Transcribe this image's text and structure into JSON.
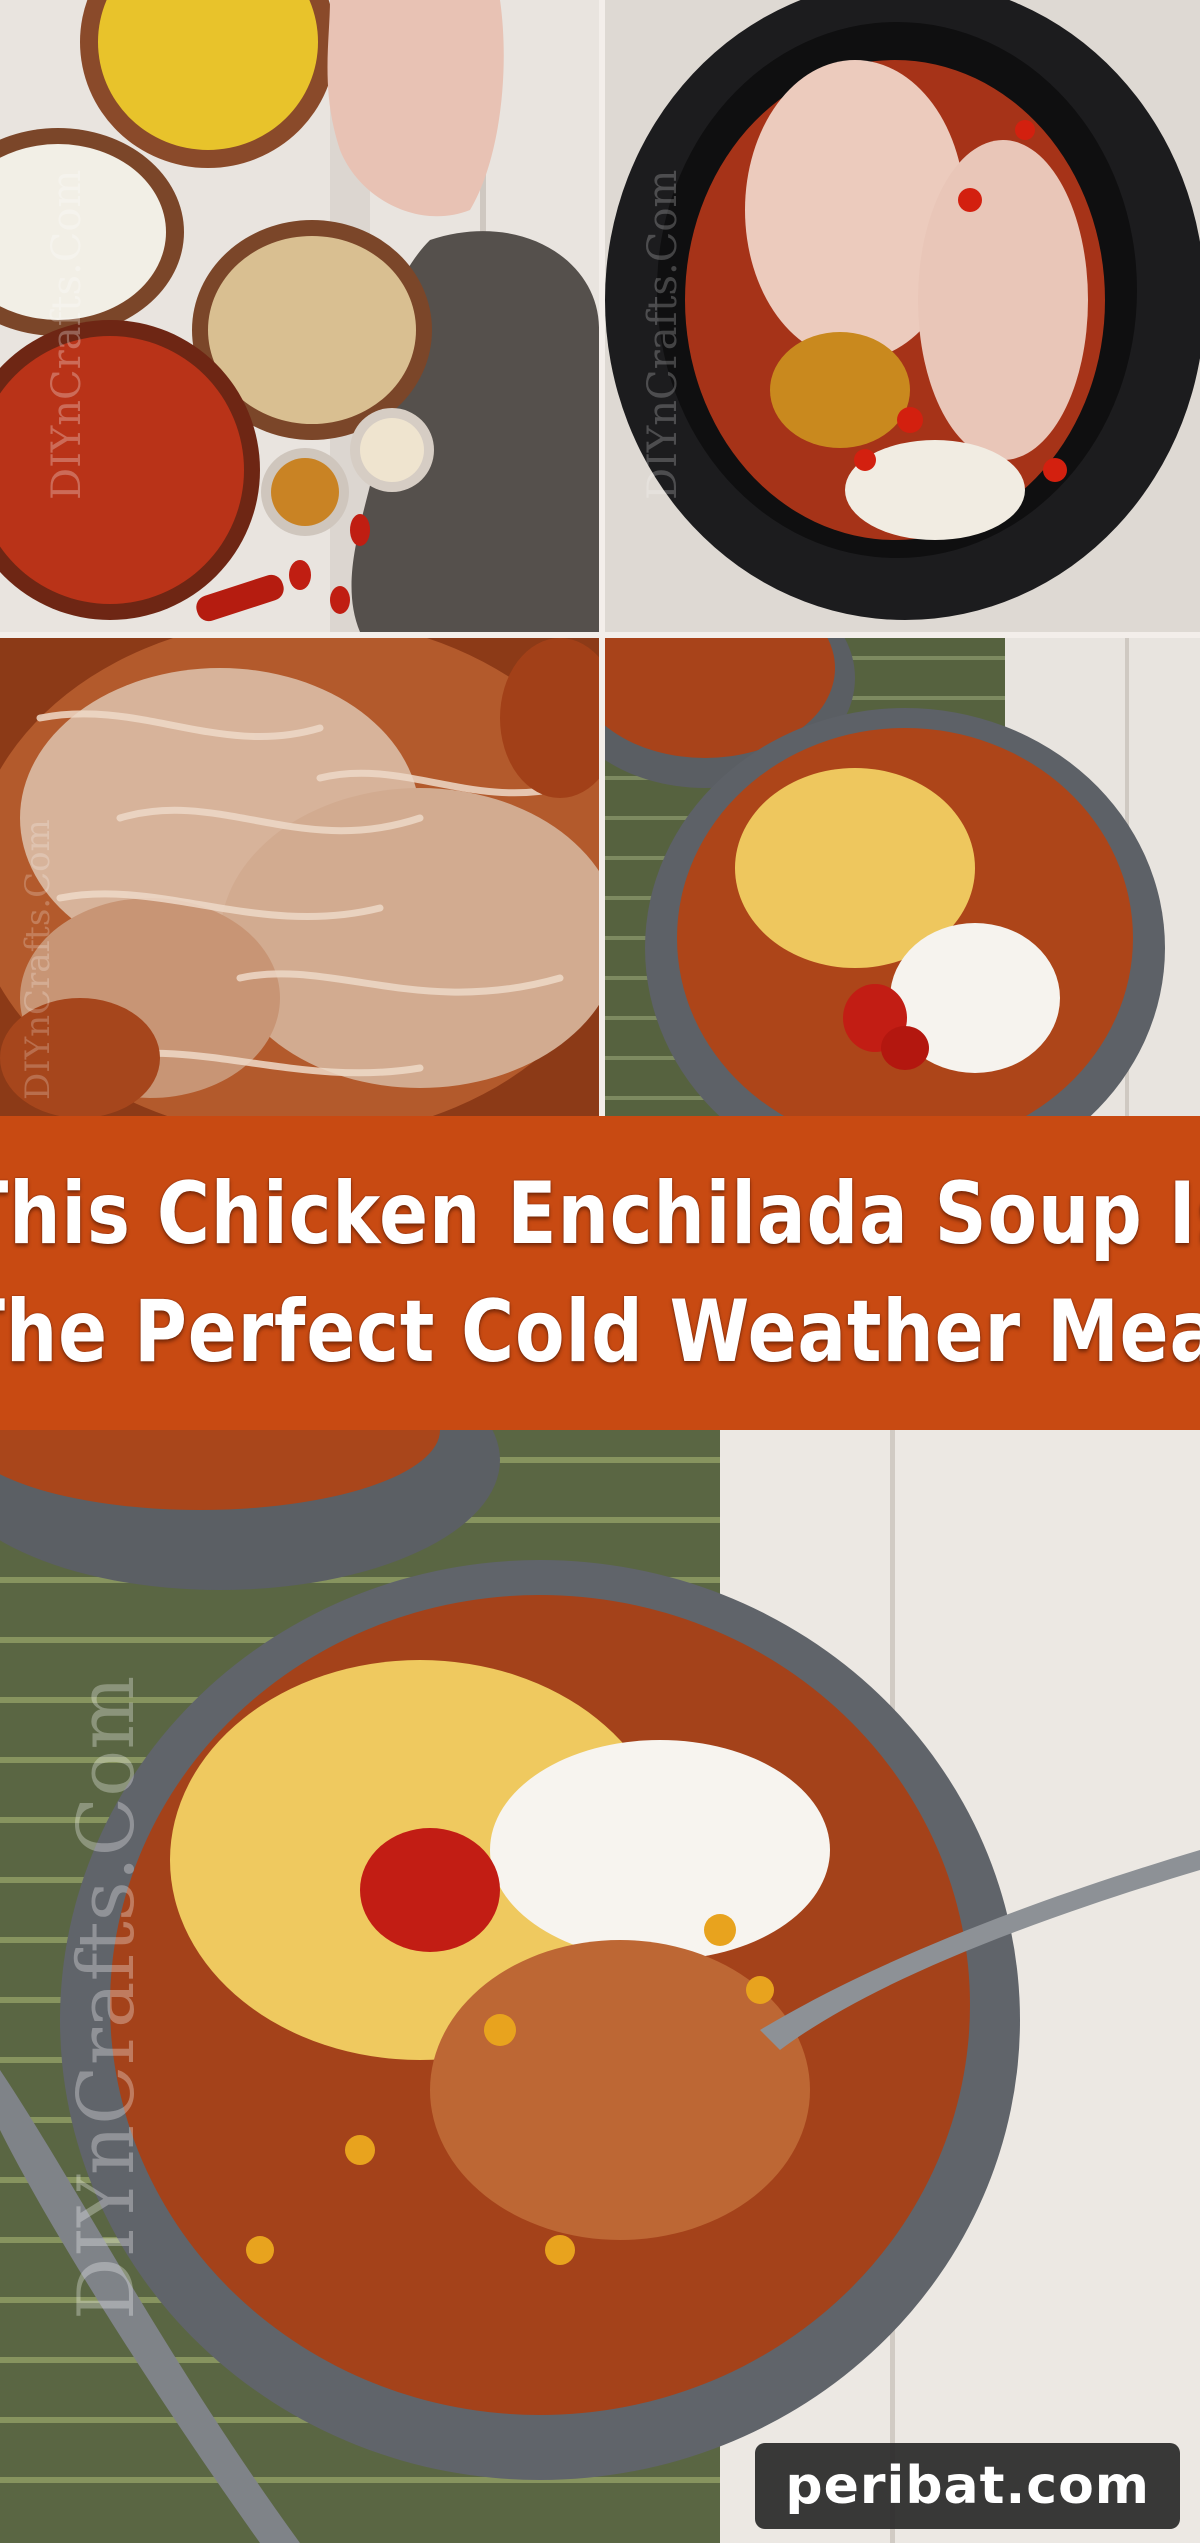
{
  "banner": {
    "line1": "This Chicken Enchilada Soup Is",
    "line2": "The Perfect Cold Weather Meal",
    "background": "#c84a12"
  },
  "photos": {
    "ingredients": "ingredients-photo",
    "slow_cooker": "slow-cooker-photo",
    "shredded_chicken": "shredded-chicken-photo",
    "soup_bowl_small": "soup-bowl-photo",
    "soup_bowl_large": "soup-bowl-with-spoon-photo"
  },
  "watermark": {
    "text": "DIYnCrafts.Com"
  },
  "site_badge": {
    "label": "peribat.com"
  },
  "colors": {
    "accent": "#c84a12",
    "badge": "#282828"
  }
}
